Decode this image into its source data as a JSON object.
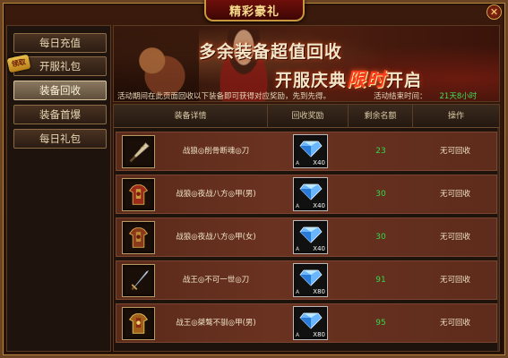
{
  "window": {
    "title": "精彩豪礼",
    "close": "✕"
  },
  "sidebar": {
    "badge": "领取",
    "tabs": [
      {
        "label": "每日充值",
        "active": false
      },
      {
        "label": "开服礼包",
        "active": false
      },
      {
        "label": "装备回收",
        "active": true
      },
      {
        "label": "装备首爆",
        "active": false
      },
      {
        "label": "每日礼包",
        "active": false
      }
    ]
  },
  "banner": {
    "line1": "多余装备超值回收",
    "line2_pre": "开服庆典",
    "line2_limited": "限时",
    "line2_post": "开启",
    "description": "活动期间在此页面回收以下装备即可获得对应奖励，先到先得。",
    "time_label": "活动结束时间：",
    "time_value": "21天8小时"
  },
  "table": {
    "headers": {
      "item": "装备详情",
      "reward": "回收奖励",
      "remaining": "剩余名额",
      "action": "操作"
    },
    "rows": [
      {
        "item_name": "战狼◎削骨断魂◎刀",
        "icon": "cleaver-icon",
        "reward_qty": "X40",
        "gem_mark": "A",
        "remaining": "23",
        "action": "无可回收"
      },
      {
        "item_name": "战狼◎夜战八方◎甲(男)",
        "icon": "armor-icon",
        "reward_qty": "X40",
        "gem_mark": "A",
        "remaining": "30",
        "action": "无可回收"
      },
      {
        "item_name": "战狼◎夜战八方◎甲(女)",
        "icon": "armor-icon",
        "reward_qty": "X40",
        "gem_mark": "A",
        "remaining": "30",
        "action": "无可回收"
      },
      {
        "item_name": "战王◎不可一世◎刀",
        "icon": "sword-icon",
        "reward_qty": "X80",
        "gem_mark": "A",
        "remaining": "91",
        "action": "无可回收"
      },
      {
        "item_name": "战王◎桀骜不驯◎甲(男)",
        "icon": "armor-icon",
        "reward_qty": "X80",
        "gem_mark": "A",
        "remaining": "95",
        "action": "无可回收"
      }
    ]
  },
  "colors": {
    "remaining_text": "#35d64a",
    "time_value": "#38e05a",
    "limited_text": "#ff3b1f"
  }
}
